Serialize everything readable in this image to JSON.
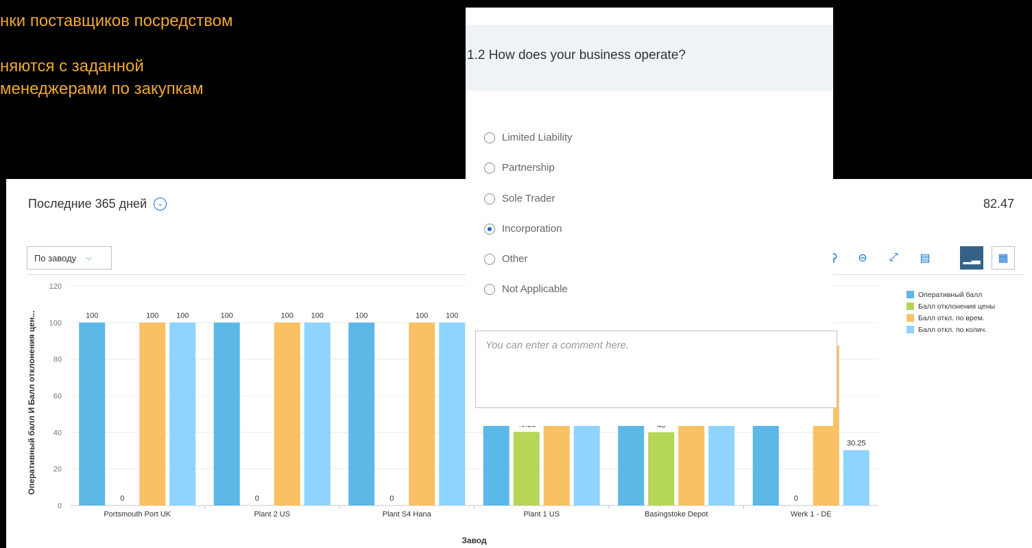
{
  "slide": {
    "lines": [
      "нки поставщиков посредством",
      "няются с заданной",
      "менеджерами по закупкам"
    ],
    "text_color": "#f0a830"
  },
  "header": {
    "period_label": "Последние 365 дней",
    "period_icon": "chevron-down-circle-icon",
    "score": "82.47"
  },
  "toolbar": {
    "group_select": "По заводу",
    "buttons": [
      {
        "name": "zoom-in-icon",
        "glyph": "⌕"
      },
      {
        "name": "zoom-out-icon",
        "glyph": "⊖"
      },
      {
        "name": "fullscreen-icon",
        "glyph": "⤢"
      },
      {
        "name": "export-icon",
        "glyph": "▤"
      },
      {
        "name": "chart-view-icon",
        "glyph": "ıl"
      },
      {
        "name": "table-view-icon",
        "glyph": "▦"
      }
    ]
  },
  "chart_data": {
    "type": "bar",
    "xlabel": "Завод",
    "ylabel": "Оперативный балл И Балл отклонения цен...",
    "ylim": [
      0,
      120
    ],
    "yticks": [
      0,
      20,
      40,
      60,
      80,
      100,
      120
    ],
    "categories": [
      "Portsmouth Port UK",
      "Plant 2 US",
      "Plant S4 Hana",
      "Plant 1 US",
      "Basingstoke Depot",
      "Werk 1 - DE"
    ],
    "series": [
      {
        "name": "Оперативный балл",
        "color": "#5cb8e6",
        "values": [
          100,
          100,
          100,
          46,
          46,
          46
        ]
      },
      {
        "name": "Балл отклонения цены",
        "color": "#b5d657",
        "values": [
          0,
          0,
          0,
          40.23,
          40,
          0
        ]
      },
      {
        "name": "Балл откл. по врем.",
        "color": "#f9c163",
        "values": [
          100,
          100,
          100,
          46,
          46,
          87.5
        ]
      },
      {
        "name": "Балл откл. по колич.",
        "color": "#8fd3ff",
        "values": [
          100,
          100,
          100,
          46,
          46,
          30.25
        ]
      }
    ],
    "data_labels": [
      {
        "category": 0,
        "series": 0,
        "text": "100"
      },
      {
        "category": 0,
        "series": 1,
        "text": "0"
      },
      {
        "category": 0,
        "series": 2,
        "text": "100"
      },
      {
        "category": 0,
        "series": 3,
        "text": "100"
      },
      {
        "category": 1,
        "series": 0,
        "text": "100"
      },
      {
        "category": 1,
        "series": 1,
        "text": "0"
      },
      {
        "category": 1,
        "series": 2,
        "text": "100"
      },
      {
        "category": 1,
        "series": 3,
        "text": "100"
      },
      {
        "category": 2,
        "series": 0,
        "text": "100"
      },
      {
        "category": 2,
        "series": 1,
        "text": "0"
      },
      {
        "category": 2,
        "series": 2,
        "text": "100"
      },
      {
        "category": 2,
        "series": 3,
        "text": "100"
      },
      {
        "category": 3,
        "series": 1,
        "text": "40.23"
      },
      {
        "category": 4,
        "series": 1,
        "text": "40"
      },
      {
        "category": 5,
        "series": 1,
        "text": "0"
      },
      {
        "category": 5,
        "series": 3,
        "text": "30.25"
      }
    ],
    "legend_position": "top-right",
    "grid": true
  },
  "form": {
    "question": "1.2 How does your business operate?",
    "options": [
      {
        "label": "Limited Liability",
        "checked": false
      },
      {
        "label": "Partnership",
        "checked": false
      },
      {
        "label": "Sole Trader",
        "checked": false
      },
      {
        "label": "Incorporation",
        "checked": true
      },
      {
        "label": "Other",
        "checked": false
      },
      {
        "label": "Not Applicable",
        "checked": false
      }
    ],
    "comment_placeholder": "You can enter a comment here."
  }
}
